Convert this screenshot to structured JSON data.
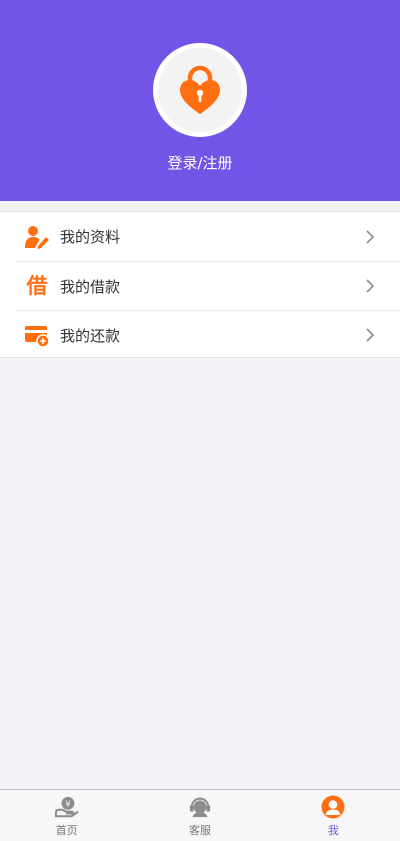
{
  "header": {
    "login_label": "登录/注册",
    "avatar_icon": "heart-lock-icon",
    "bg_color": "#7255e6",
    "accent_color": "#ff6f0f"
  },
  "menu": {
    "items": [
      {
        "label": "我的资料",
        "icon": "profile-edit-icon"
      },
      {
        "label": "我的借款",
        "icon": "borrow-icon",
        "icon_text": "借"
      },
      {
        "label": "我的还款",
        "icon": "repay-card-icon"
      }
    ]
  },
  "tabbar": {
    "tabs": [
      {
        "label": "首页",
        "icon": "home-money-icon",
        "active": false
      },
      {
        "label": "客服",
        "icon": "customer-service-icon",
        "active": false
      },
      {
        "label": "我",
        "icon": "user-icon",
        "active": true
      }
    ]
  }
}
